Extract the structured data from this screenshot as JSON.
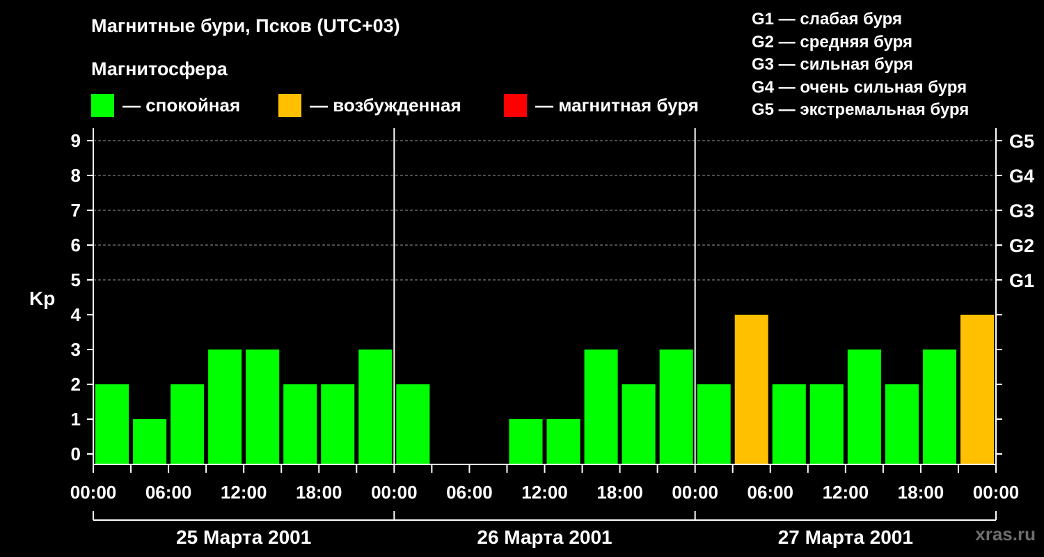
{
  "header": {
    "title": "Магнитные бури, Псков (UTC+03)",
    "subtitle": "Магнитосфера"
  },
  "legend": {
    "calm": {
      "label": "— спокойная",
      "color": "#00ff00"
    },
    "excited": {
      "label": "— возбужденная",
      "color": "#ffc000"
    },
    "storm": {
      "label": "— магнитная буря",
      "color": "#ff0000"
    }
  },
  "g_legend": [
    "G1 — слабая буря",
    "G2 — средняя буря",
    "G3 — сильная буря",
    "G4 — очень сильная буря",
    "G5 — экстремальная буря"
  ],
  "brand": "xras.ru",
  "chart_data": {
    "type": "bar",
    "ylabel": "Kp",
    "ylim": [
      0,
      9
    ],
    "y_ticks": [
      "0",
      "1",
      "2",
      "3",
      "4",
      "5",
      "6",
      "7",
      "8",
      "9"
    ],
    "right_ticks": [
      {
        "kp": 5,
        "label": "G1"
      },
      {
        "kp": 6,
        "label": "G2"
      },
      {
        "kp": 7,
        "label": "G3"
      },
      {
        "kp": 8,
        "label": "G4"
      },
      {
        "kp": 9,
        "label": "G5"
      }
    ],
    "x_tick_labels": [
      "00:00",
      "06:00",
      "12:00",
      "18:00",
      "00:00",
      "06:00",
      "12:00",
      "18:00",
      "00:00",
      "06:00",
      "12:00",
      "18:00",
      "00:00"
    ],
    "days": [
      "25 Марта 2001",
      "26 Марта 2001",
      "27 Марта 2001"
    ],
    "interval_hours": 3,
    "values": [
      2,
      1,
      2,
      3,
      3,
      2,
      2,
      3,
      2,
      0,
      0,
      1,
      1,
      3,
      2,
      3,
      2,
      4,
      2,
      2,
      3,
      2,
      3,
      4
    ],
    "grid": "dashed at Kp 5-9",
    "colors": {
      "calm": "#00ff00",
      "excited": "#ffc000",
      "storm": "#ff0000"
    }
  }
}
